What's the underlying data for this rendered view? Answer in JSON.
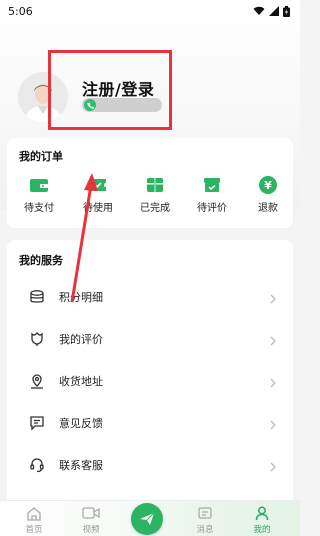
{
  "status_bar": {
    "time": "5:06",
    "icons": [
      "wifi-icon",
      "signal-icon",
      "battery-icon"
    ]
  },
  "profile": {
    "login_label": "注册/登录",
    "avatar_icon": "avatar-icon",
    "phone_icon": "phone-icon"
  },
  "orders": {
    "title": "我的订单",
    "items": [
      {
        "label": "待支付",
        "icon": "wallet-icon"
      },
      {
        "label": "待使用",
        "icon": "ticket-icon"
      },
      {
        "label": "已完成",
        "icon": "package-icon"
      },
      {
        "label": "待评价",
        "icon": "review-box-icon"
      },
      {
        "label": "退款",
        "icon": "yen-icon"
      }
    ]
  },
  "services": {
    "title": "我的服务",
    "items": [
      {
        "label": "积分明细",
        "icon": "coins-icon"
      },
      {
        "label": "我的评价",
        "icon": "flower-icon"
      },
      {
        "label": "收货地址",
        "icon": "location-icon"
      },
      {
        "label": "意见反馈",
        "icon": "feedback-icon"
      },
      {
        "label": "联系客服",
        "icon": "headset-icon"
      }
    ]
  },
  "bottom_nav": {
    "items": [
      {
        "label": "首页",
        "icon": "home-icon"
      },
      {
        "label": "视频",
        "icon": "video-icon"
      },
      {
        "label": "消息",
        "icon": "message-icon"
      },
      {
        "label": "我的",
        "icon": "person-icon"
      }
    ],
    "center_icon": "send-icon"
  },
  "colors": {
    "accent": "#2bb563",
    "annotation": "#e8323c"
  }
}
